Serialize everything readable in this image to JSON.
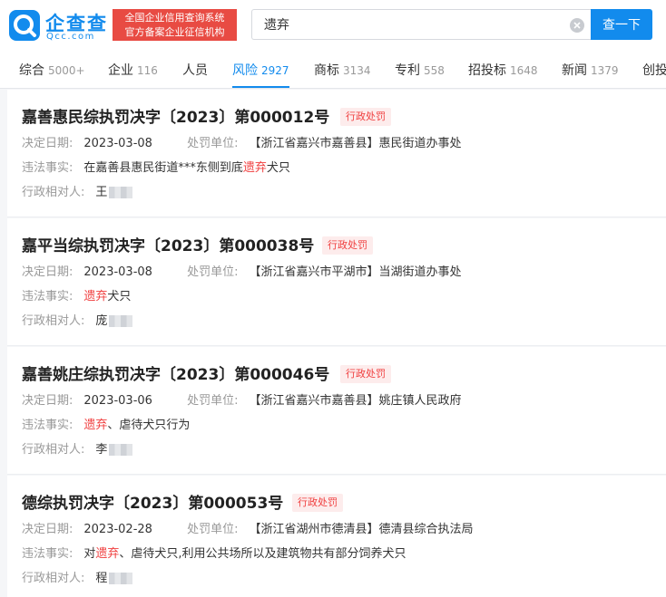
{
  "brand": {
    "name": "企查查",
    "domain": "Qcc.com",
    "cert_line1": "全国企业信用查询系统",
    "cert_line2": "官方备案企业征信机构"
  },
  "search": {
    "value": "遗弃",
    "button": "查一下"
  },
  "tabs": [
    {
      "label": "综合",
      "count": "5000+"
    },
    {
      "label": "企业",
      "count": "116"
    },
    {
      "label": "人员",
      "count": ""
    },
    {
      "label": "风险",
      "count": "2927",
      "active": true
    },
    {
      "label": "商标",
      "count": "3134"
    },
    {
      "label": "专利",
      "count": "558"
    },
    {
      "label": "招投标",
      "count": "1648"
    },
    {
      "label": "新闻",
      "count": "1379"
    },
    {
      "label": "创投",
      "count": ""
    }
  ],
  "colors": {
    "accent": "#128bed",
    "badge_text": "#f04040",
    "badge_bg": "#fdecec",
    "brand_red": "#e84b43"
  },
  "labels": {
    "decision_date": "决定日期:",
    "penalty_unit": "处罚单位:",
    "violation": "违法事实:",
    "party": "行政相对人:"
  },
  "results": [
    {
      "title": "嘉善惠民综执罚决字〔2023〕第000012号",
      "badge": "行政处罚",
      "date": "2023-03-08",
      "unit": "【浙江省嘉兴市嘉善县】惠民街道办事处",
      "fact_pre": "在嘉善县惠民街道***东侧到底",
      "fact_hl": "遗弃",
      "fact_post": "犬只",
      "party": "王"
    },
    {
      "title": "嘉平当综执罚决字〔2023〕第000038号",
      "badge": "行政处罚",
      "date": "2023-03-08",
      "unit": "【浙江省嘉兴市平湖市】当湖街道办事处",
      "fact_pre": "",
      "fact_hl": "遗弃",
      "fact_post": "犬只",
      "party": "庞"
    },
    {
      "title": "嘉善姚庄综执罚决字〔2023〕第000046号",
      "badge": "行政处罚",
      "date": "2023-03-06",
      "unit": "【浙江省嘉兴市嘉善县】姚庄镇人民政府",
      "fact_pre": "",
      "fact_hl": "遗弃",
      "fact_post": "、虐待犬只行为",
      "party": "李"
    },
    {
      "title": "德综执罚决字〔2023〕第000053号",
      "badge": "行政处罚",
      "date": "2023-02-28",
      "unit": "【浙江省湖州市德清县】德清县综合执法局",
      "fact_pre": "对",
      "fact_hl": "遗弃",
      "fact_post": "、虐待犬只,利用公共场所以及建筑物共有部分饲养犬只",
      "party": "程"
    }
  ]
}
